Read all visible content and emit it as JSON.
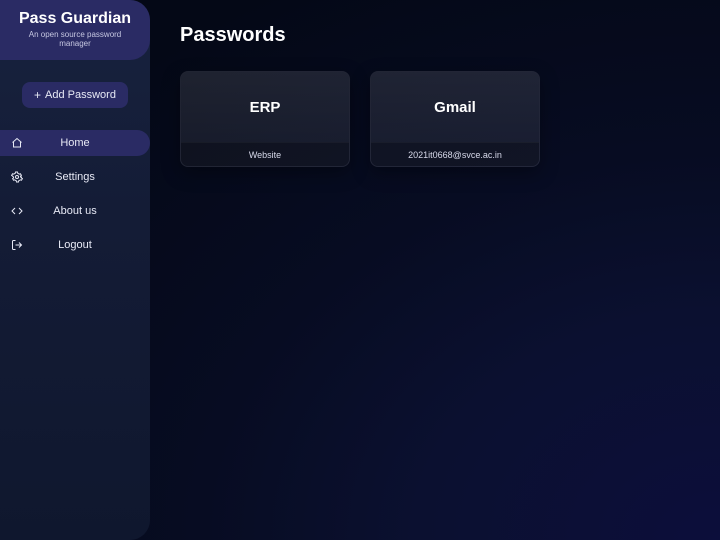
{
  "brand": {
    "title": "Pass Guardian",
    "subtitle": "An open source password manager"
  },
  "sidebar": {
    "add_label": "Add Password",
    "items": [
      {
        "label": "Home",
        "icon": "home-icon",
        "active": true
      },
      {
        "label": "Settings",
        "icon": "gear-icon",
        "active": false
      },
      {
        "label": "About us",
        "icon": "code-icon",
        "active": false
      },
      {
        "label": "Logout",
        "icon": "logout-icon",
        "active": false
      }
    ]
  },
  "main": {
    "title": "Passwords",
    "cards": [
      {
        "title": "ERP",
        "subtitle": "Website"
      },
      {
        "title": "Gmail",
        "subtitle": "2021it0668@svce.ac.in"
      }
    ]
  }
}
